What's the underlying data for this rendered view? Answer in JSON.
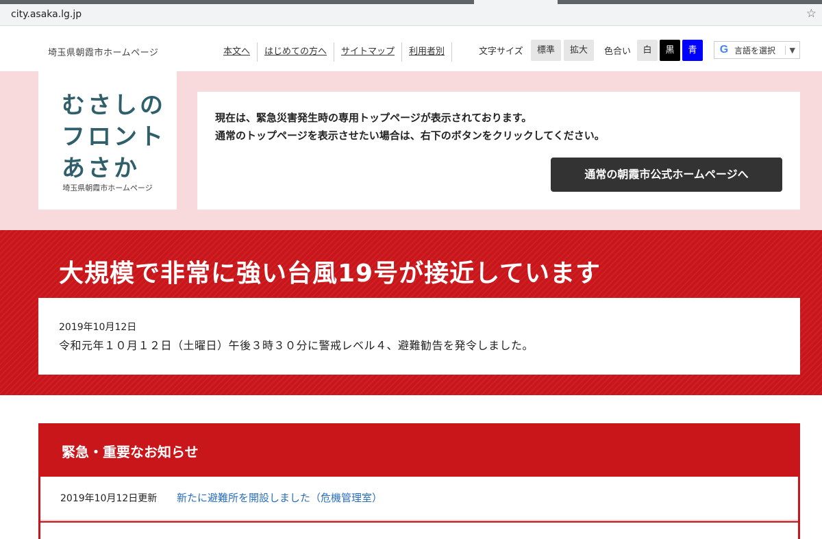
{
  "browser": {
    "url": "city.asaka.lg.jp"
  },
  "header": {
    "site_name": "埼玉県朝霞市ホームページ",
    "nav": [
      "本文へ",
      "はじめての方へ",
      "サイトマップ",
      "利用者別"
    ],
    "font_size_label": "文字サイズ",
    "font_size_standard": "標準",
    "font_size_large": "拡大",
    "color_label": "色合い",
    "color_white": "白",
    "color_black": "黒",
    "color_blue": "青",
    "translate_label": "言語を選択",
    "translate_caret": "▼",
    "google_letter": "G"
  },
  "logo": {
    "line1": "むさしの",
    "line2": "フロント",
    "line3": "あさか",
    "subtitle": "埼玉県朝霞市ホームページ"
  },
  "notice": {
    "line1": "現在は、緊急災害発生時の専用トップページが表示されております。",
    "line2": "通常のトップページを表示させたい場合は、右下のボタンをクリックしてください。",
    "button": "通常の朝霞市公式ホームページへ"
  },
  "alert": {
    "title": "大規模で非常に強い台風19号が接近しています",
    "date": "2019年10月12日",
    "text": "令和元年１０月１２日（土曜日）午後３時３０分に警戒レベル４、避難勧告を発令しました。"
  },
  "important": {
    "title": "緊急・重要なお知らせ",
    "items": [
      {
        "date": "2019年10月12日更新",
        "link": "新たに避難所を開設しました（危機管理室）"
      }
    ]
  },
  "colors": {
    "red": "#c9161b",
    "pink": "#f8dadc",
    "dark_button": "#333333",
    "blue_btn": "#0000ff",
    "link": "#2a6ebb"
  }
}
